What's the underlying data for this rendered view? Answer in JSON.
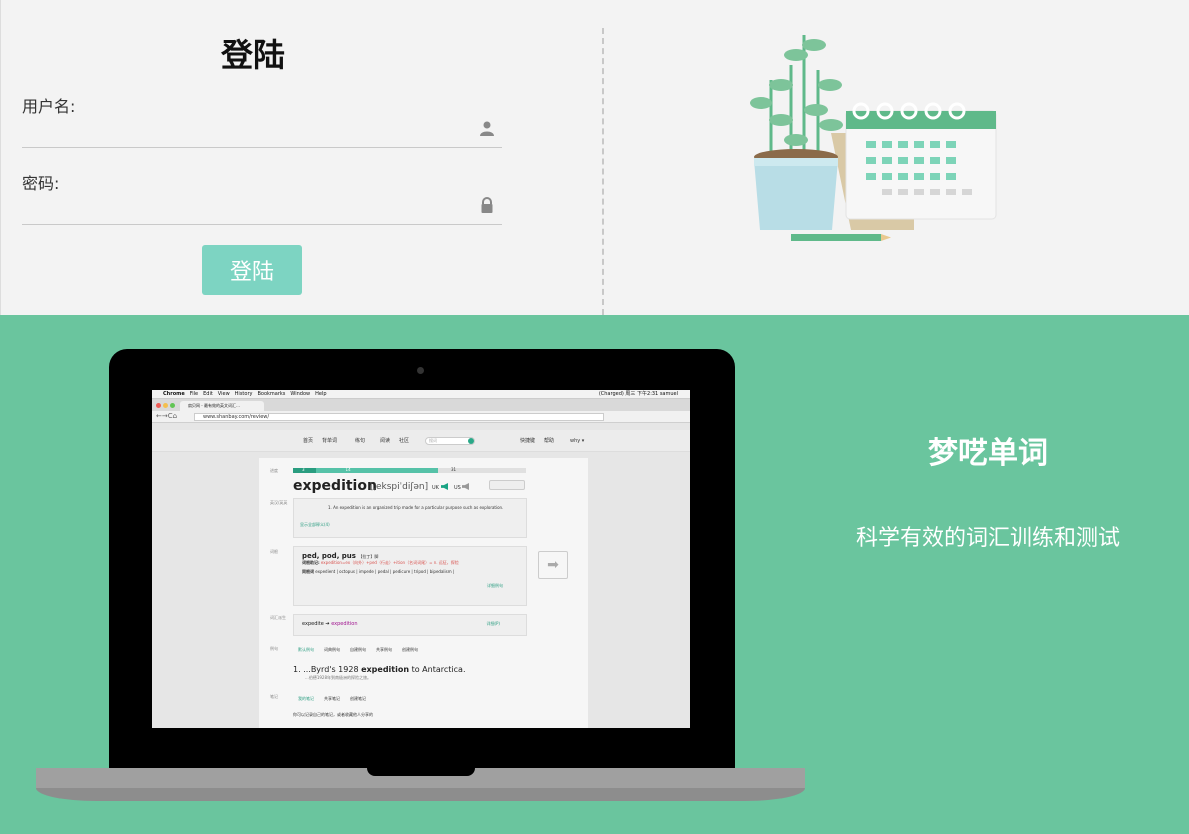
{
  "login": {
    "title": "登陆",
    "username_label": "用户名:",
    "password_label": "密码:",
    "submit_label": "登陆"
  },
  "promo": {
    "app_name": "梦呓单词",
    "tagline": "科学有效的词汇训练和测试"
  },
  "colors": {
    "page_bg": "#f3f3f3",
    "promo_bg": "#6ac59e",
    "button_bg": "#7dd4c2",
    "accent": "#2a9d80"
  },
  "laptop_screen": {
    "menubar": {
      "apple": "",
      "items": [
        "Chrome",
        "File",
        "Edit",
        "View",
        "History",
        "Bookmarks",
        "Window",
        "Help"
      ],
      "status": "(Charged)  周三 下午2:31  samuel"
    },
    "tab_title": "扇贝网 - 最有效的英文词汇…",
    "url": "www.shanbay.com/review/",
    "site_nav": {
      "items": [
        "首页",
        "背单词",
        "练句",
        "阅读",
        "社区"
      ],
      "search_placeholder": "搜词",
      "right_items": [
        "快捷键",
        "帮助",
        "why ▾"
      ]
    },
    "progress": {
      "label": "进度",
      "done": 3,
      "current": 14,
      "total": 31
    },
    "word": "expedition",
    "phonetic": "[ˌekspiˈdiʃən]",
    "accent_uk": "UK",
    "accent_us": "US",
    "side_labels": {
      "definition": "英汉/英英",
      "roots": "词根",
      "derivation": "词汇派生",
      "examples": "例句",
      "notes": "笔记"
    },
    "definition": {
      "number": "1.",
      "text": "An expedition is an organized trip made for a particular purpose such as exploration.",
      "show_all": "显示全部释义(4)"
    },
    "roots": {
      "head": "ped, pod, pus",
      "head_suffix": "【拉丁】脚",
      "memo_label": "词根助记:",
      "memo": "expedition=ex（向外）+ped（行走）+ition（名词词尾）= n. 远征，探险",
      "same_root_label": "同根词",
      "same_root": "expedient | octopus | impede | pedal | pedicure | tripod | bipedalism |",
      "detail": "详细例句"
    },
    "derivation": {
      "from": "expedite",
      "arrow": "➔",
      "to": "expedition",
      "detail": "详细(P)"
    },
    "example_tabs": [
      "默认例句",
      "词典例句",
      "自建例句",
      "共享例句",
      "创建例句"
    ],
    "example": {
      "number": "1.",
      "prefix": "...Byrd's 1928",
      "word": "expedition",
      "suffix": "to Antarctica.",
      "translation": "...伯德1928年到南极洲的探险之旅。"
    },
    "note_tabs": [
      "我的笔记",
      "共享笔记",
      "创建笔记"
    ],
    "note_hint": "你可以记录自己的笔记，或者收藏他人分享的",
    "next_icon": "➡"
  }
}
